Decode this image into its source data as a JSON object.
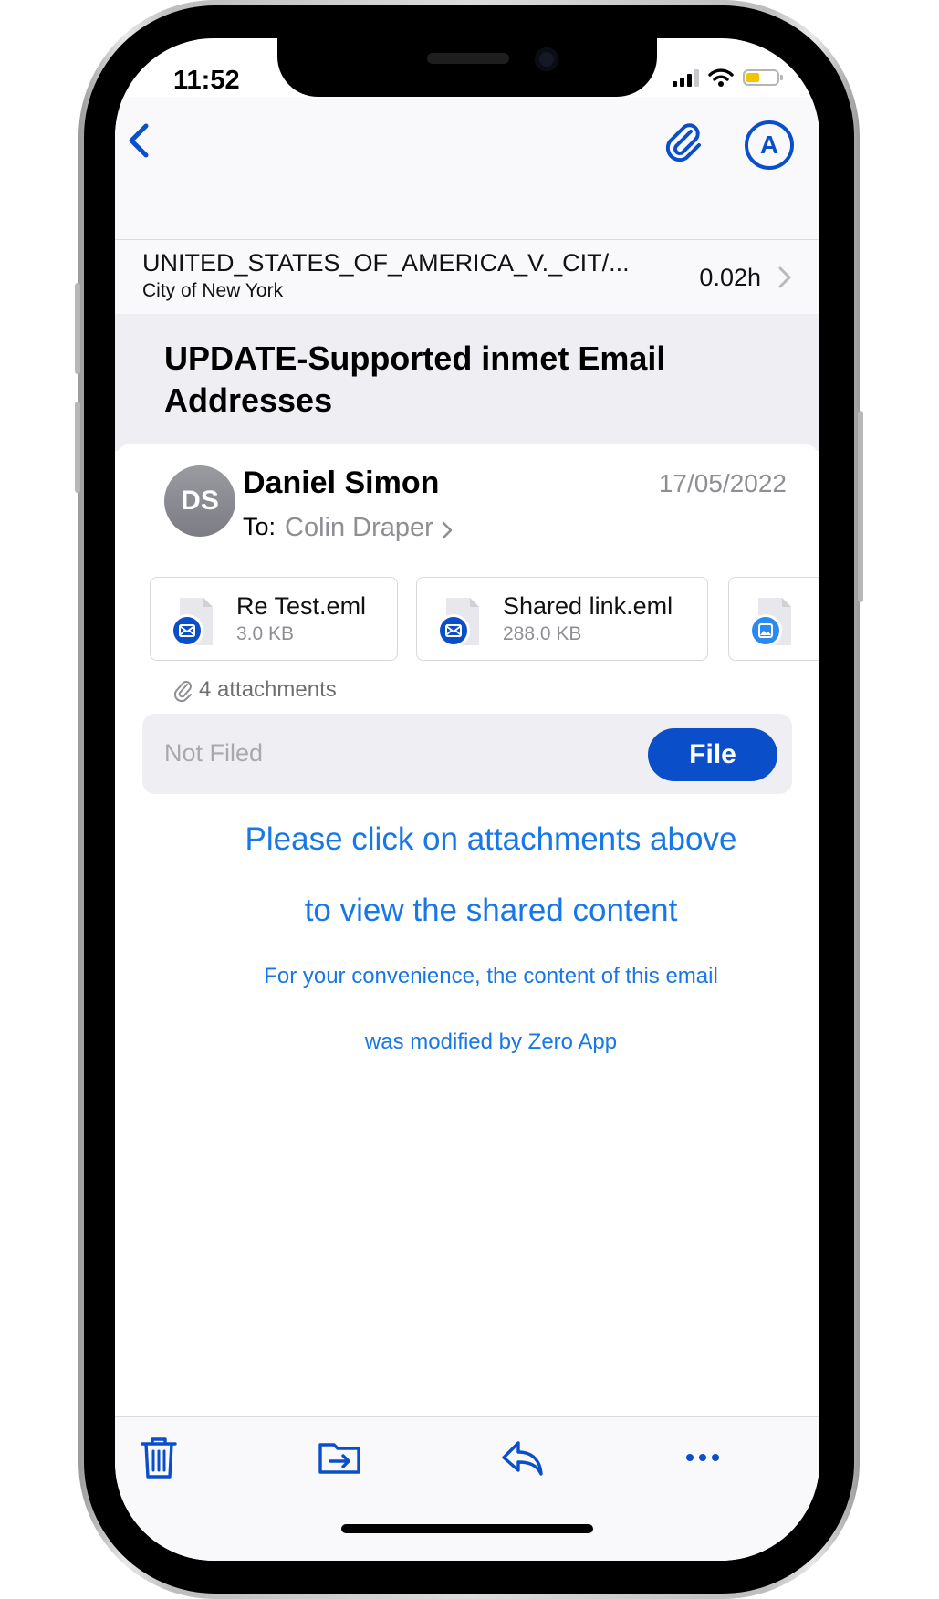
{
  "status_bar": {
    "time": "11:52"
  },
  "matter": {
    "name": "UNITED_STATES_OF_AMERICA_V._CIT/...",
    "client": "City of New York",
    "time": "0.02h"
  },
  "email": {
    "subject": "UPDATE-Supported inmet Email Addresses",
    "avatar_initials": "DS",
    "sender": "Daniel Simon",
    "date": "17/05/2022",
    "to_label": "To:",
    "recipient": "Colin Draper"
  },
  "attachments": {
    "items": [
      {
        "name": "Re Test.eml",
        "size": "3.0 KB",
        "icon": "email-icon"
      },
      {
        "name": "Shared link.eml",
        "size": "288.0 KB",
        "icon": "email-icon"
      },
      {
        "name": "",
        "size": "",
        "icon": "image-icon"
      }
    ],
    "count_label": "4 attachments"
  },
  "filing": {
    "status": "Not Filed",
    "button_label": "File"
  },
  "body": {
    "line1": "Please click on attachments above",
    "line2": "to view the shared content",
    "line3": "For your convenience, the content of this email",
    "line4": "was modified by Zero App"
  },
  "colors": {
    "accent": "#0a4fc9",
    "link": "#1777e6",
    "secondary_text": "#8e8e93"
  },
  "toolbar_icons": [
    "trash-icon",
    "move-to-folder-icon",
    "reply-icon",
    "more-icon"
  ]
}
